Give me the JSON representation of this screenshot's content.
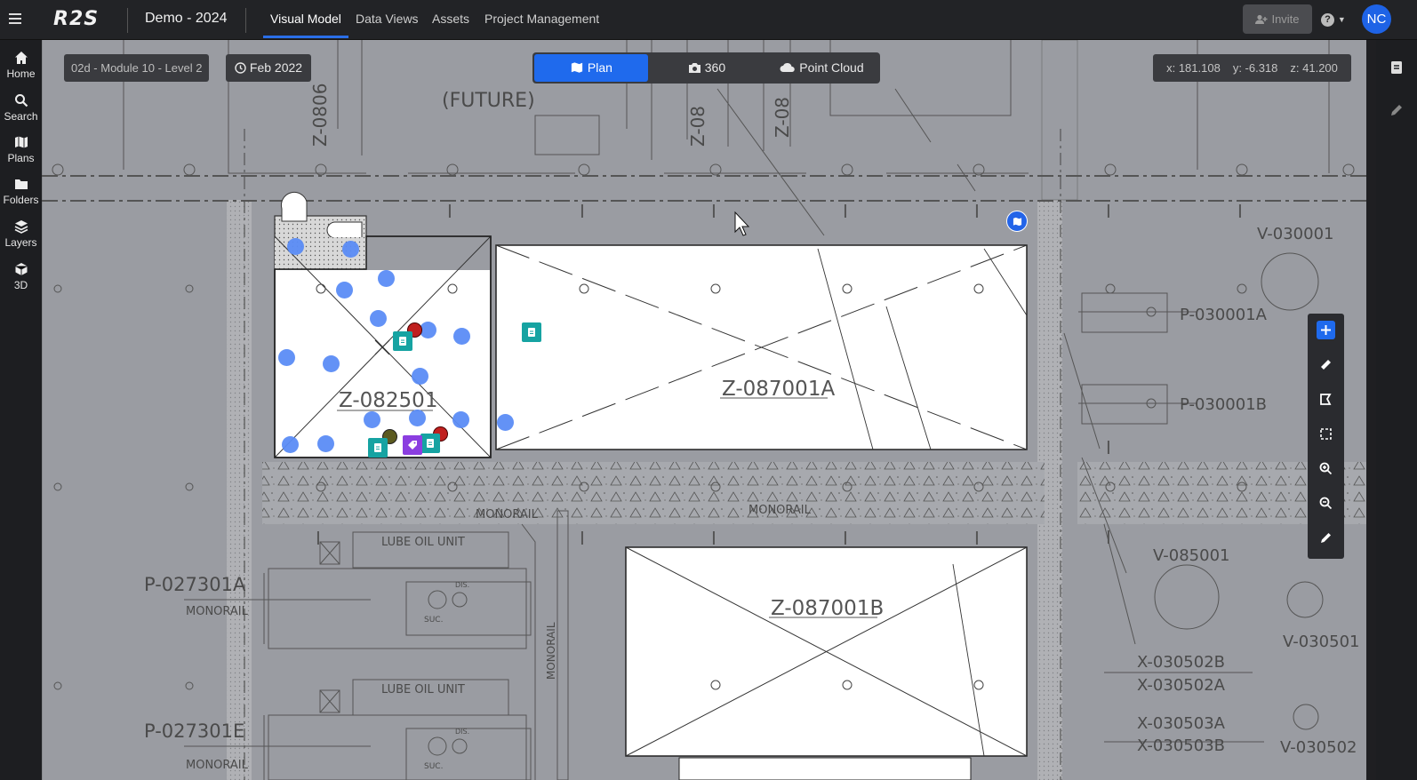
{
  "app": {
    "logo_text": "R2S",
    "project": "Demo - 2024",
    "nav": [
      "Visual Model",
      "Data Views",
      "Assets",
      "Project Management"
    ],
    "invite_label": "Invite",
    "help_label": "?",
    "user_initials": "NC",
    "accent_color": "#1f6aed"
  },
  "sidebar": {
    "items": [
      {
        "label": "Home",
        "icon": "home-icon"
      },
      {
        "label": "Search",
        "icon": "search-icon"
      },
      {
        "label": "Plans",
        "icon": "map-icon"
      },
      {
        "label": "Folders",
        "icon": "folder-icon"
      },
      {
        "label": "Layers",
        "icon": "layers-icon"
      },
      {
        "label": "3D",
        "icon": "cube-icon"
      }
    ]
  },
  "viewer": {
    "location": "02d - Module 10 - Level 2",
    "date": "Feb 2022",
    "modes": [
      "Plan",
      "360",
      "Point Cloud"
    ],
    "active_mode": "Plan",
    "coords": {
      "x": "x: 181.108",
      "y": "y: -6.318",
      "z": "z: 41.200"
    }
  },
  "plan_labels": {
    "future": "(FUTURE)",
    "z082501": "Z-082501",
    "z087001a": "Z-087001A",
    "z087001b": "Z-087001B",
    "monorail": "MONORAIL",
    "lube_oil_unit": "LUBE OIL UNIT",
    "p027301a": "P-027301A",
    "p027301b": "P-027301E",
    "v030001": "V-030001",
    "p030001a": "P-030001A",
    "p030001b": "P-030001B",
    "v085001": "V-085001",
    "v030501": "V-030501",
    "x030502b": "X-030502B",
    "x030502a": "X-030502A",
    "x030503a": "X-030503A",
    "x030503b": "X-030503B",
    "v030502": "V-030502",
    "z0806": "Z-0806",
    "z08b": "Z-08",
    "z08c": "Z-08",
    "suc": "SUC.",
    "dis": "DIS."
  },
  "right_tools": [
    "add-icon",
    "ruler-icon",
    "polygon-icon",
    "select-box-icon",
    "zoom-in-icon",
    "zoom-out-icon",
    "pencil-icon"
  ]
}
